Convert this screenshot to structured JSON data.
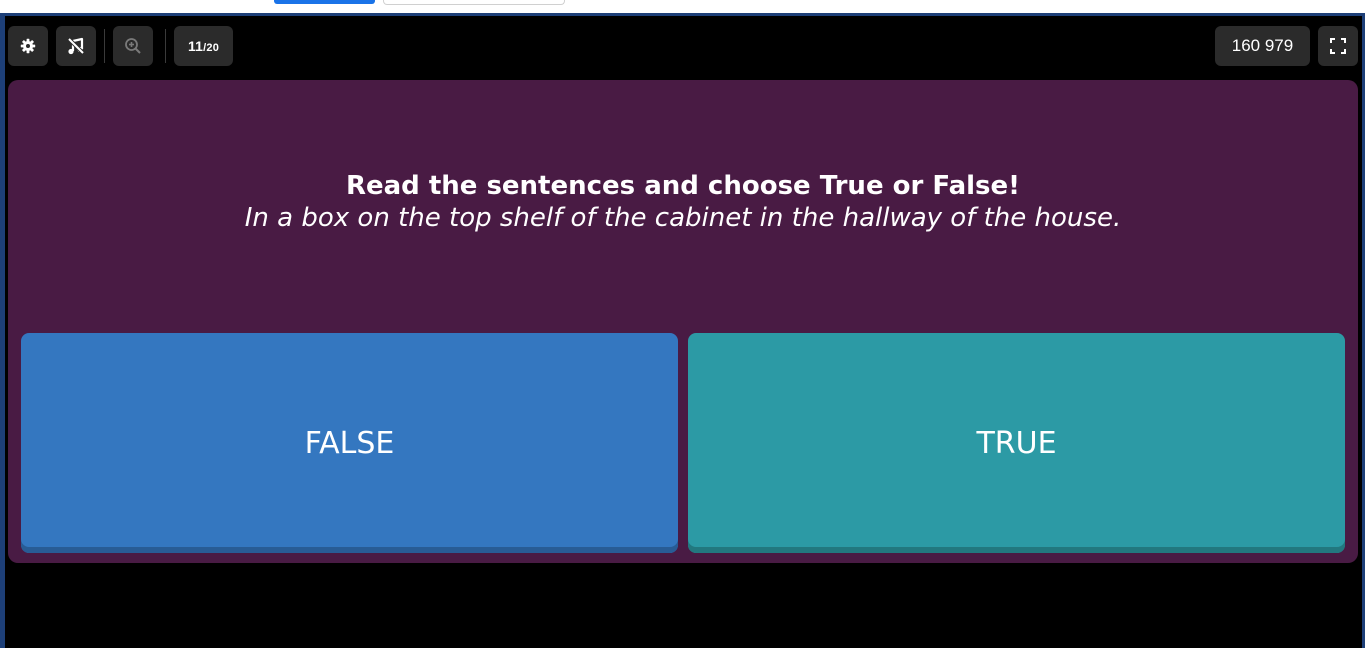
{
  "toolbar": {
    "settings_icon": "gear-icon",
    "music_icon": "music-off-icon",
    "zoom_icon": "zoom-in-icon",
    "fullscreen_icon": "fullscreen-icon",
    "counter": {
      "current": "11",
      "total": "/20"
    },
    "score": "160 979"
  },
  "question": {
    "title": "Read the sentences and choose True or False!",
    "sentence": "In a box on the top shelf of the cabinet in the hallway of the house."
  },
  "answers": [
    {
      "label": "FALSE",
      "color": "#3477c0"
    },
    {
      "label": "TRUE",
      "color": "#2c9aa5"
    }
  ],
  "colors": {
    "card_background": "#491b44",
    "stage_background": "#000000",
    "frame_border": "#1d3f78",
    "toolbar_button": "#2b2b2b"
  }
}
